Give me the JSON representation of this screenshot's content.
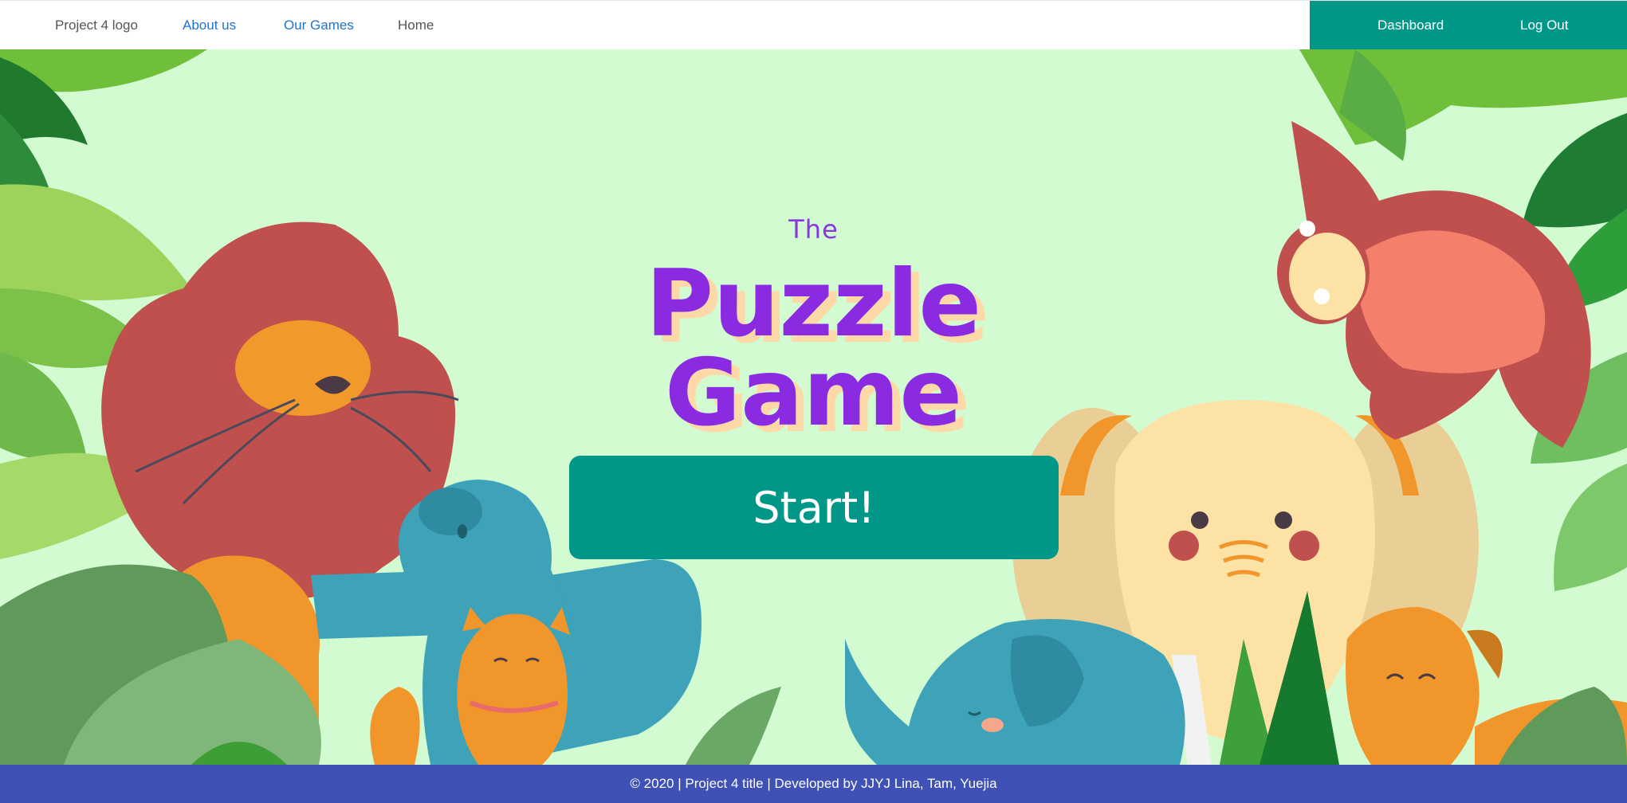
{
  "navbar": {
    "logo": "Project 4 logo",
    "about": "About us",
    "games": "Our Games",
    "home": "Home",
    "dashboard": "Dashboard",
    "logout": "Log Out"
  },
  "hero": {
    "title_small": "The",
    "title_line1": "Puzzle",
    "title_line2": "Game",
    "start_label": "Start!"
  },
  "footer": {
    "text": "© 2020 | Project 4 title | Developed by JJYJ Lina, Tam, Yuejia"
  },
  "colors": {
    "navbar_bg": "#ffffff",
    "accent_teal": "#009688",
    "background": "#d3fbd2",
    "title_purple": "#8a2be2",
    "title_shadow": "#fcd9a7",
    "footer_bg": "#3f51b5",
    "link_blue": "#1e73d2"
  }
}
